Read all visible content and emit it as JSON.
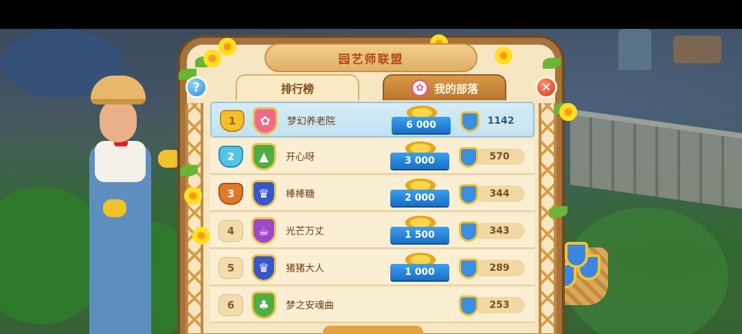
{
  "panel": {
    "title": "园艺师联盟",
    "tabs": [
      {
        "label": "排行榜",
        "active": true
      },
      {
        "label": "我的部落",
        "active": false,
        "icon": "flower-badge-icon"
      }
    ],
    "help_icon": "?",
    "close_icon": "✕"
  },
  "leaderboard": [
    {
      "rank": "1",
      "team": "梦幻养老院",
      "emblem": "flower-emblem-icon",
      "emblem_glyph": "✿",
      "reward": "6 000",
      "score": "1142"
    },
    {
      "rank": "2",
      "team": "开心呀",
      "emblem": "tree-emblem-icon",
      "emblem_glyph": "▲",
      "reward": "3 000",
      "score": "570"
    },
    {
      "rank": "3",
      "team": "棒棒糖",
      "emblem": "crown-emblem-icon",
      "emblem_glyph": "♛",
      "reward": "2 000",
      "score": "344"
    },
    {
      "rank": "4",
      "team": "光芒万丈",
      "emblem": "teacup-emblem-icon",
      "emblem_glyph": "☕",
      "reward": "1 500",
      "score": "343"
    },
    {
      "rank": "5",
      "team": "猪猪大人",
      "emblem": "crown-emblem-icon",
      "emblem_glyph": "♛",
      "reward": "1 000",
      "score": "289"
    },
    {
      "rank": "6",
      "team": "梦之安魂曲",
      "emblem": "clover-emblem-icon",
      "emblem_glyph": "♣",
      "reward": "",
      "score": "253"
    }
  ],
  "colors": {
    "panel_bg": "#f7e6c2",
    "frame": "#a8733b",
    "title_text": "#b24a12",
    "reward_blue": "#1b6fc4"
  }
}
